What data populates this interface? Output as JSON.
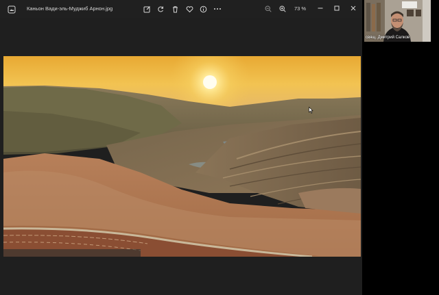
{
  "window": {
    "title": "Каньон Вади-эль-Муджиб  Арнон.jpg",
    "zoom_label": "73 %"
  },
  "toolbar": {
    "icons": [
      "edit-image-icon",
      "rotate-icon",
      "delete-icon",
      "favorite-heart-icon",
      "info-icon",
      "more-icon"
    ],
    "zoom_out": "zoom-out-icon",
    "zoom_in": "zoom-in-icon"
  },
  "participant": {
    "name": "свящ. Дмитрий Салков"
  },
  "colors": {
    "titlebar": "#202020",
    "canvas": "#1f1f1f",
    "icon": "#d8d8d8"
  }
}
